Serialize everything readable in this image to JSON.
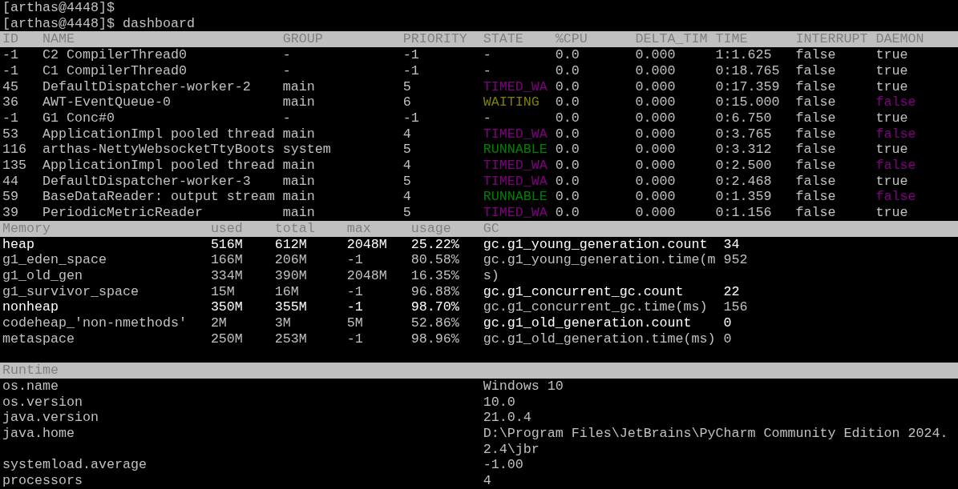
{
  "terminal": {
    "prompt_lines": [
      "[arthas@4448]$",
      "[arthas@4448]$ dashboard"
    ],
    "threads": {
      "columns": [
        "ID",
        "NAME",
        "GROUP",
        "PRIORITY",
        "STATE",
        "%CPU",
        "DELTA_TIM",
        "TIME",
        "INTERRUPT",
        "DAEMON"
      ],
      "rows": [
        {
          "id": "-1",
          "name": "C2 CompilerThread0",
          "group": "-",
          "priority": "-1",
          "state": {
            "text": "-",
            "color": "#c0c0c0"
          },
          "cpu": "0.0",
          "delta_time": "0.000",
          "time": "1:1.625",
          "interrupt": "false",
          "daemon": {
            "text": "true",
            "color": "#c0c0c0"
          }
        },
        {
          "id": "-1",
          "name": "C1 CompilerThread0",
          "group": "-",
          "priority": "-1",
          "state": {
            "text": "-",
            "color": "#c0c0c0"
          },
          "cpu": "0.0",
          "delta_time": "0.000",
          "time": "0:18.765",
          "interrupt": "false",
          "daemon": {
            "text": "true",
            "color": "#c0c0c0"
          }
        },
        {
          "id": "45",
          "name": "DefaultDispatcher-worker-2",
          "group": "main",
          "priority": "5",
          "state": {
            "text": "TIMED_WA",
            "color": "#800080"
          },
          "cpu": "0.0",
          "delta_time": "0.000",
          "time": "0:17.359",
          "interrupt": "false",
          "daemon": {
            "text": "true",
            "color": "#c0c0c0"
          }
        },
        {
          "id": "36",
          "name": "AWT-EventQueue-0",
          "group": "main",
          "priority": "6",
          "state": {
            "text": "WAITING",
            "color": "#808000"
          },
          "cpu": "0.0",
          "delta_time": "0.000",
          "time": "0:15.000",
          "interrupt": "false",
          "daemon": {
            "text": "false",
            "color": "#800080"
          }
        },
        {
          "id": "-1",
          "name": "G1 Conc#0",
          "group": "-",
          "priority": "-1",
          "state": {
            "text": "-",
            "color": "#c0c0c0"
          },
          "cpu": "0.0",
          "delta_time": "0.000",
          "time": "0:6.750",
          "interrupt": "false",
          "daemon": {
            "text": "true",
            "color": "#c0c0c0"
          }
        },
        {
          "id": "53",
          "name": "ApplicationImpl pooled thread",
          "group": "main",
          "priority": "4",
          "state": {
            "text": "TIMED_WA",
            "color": "#800080"
          },
          "cpu": "0.0",
          "delta_time": "0.000",
          "time": "0:3.765",
          "interrupt": "false",
          "daemon": {
            "text": "false",
            "color": "#800080"
          }
        },
        {
          "id": "116",
          "name": "arthas-NettyWebsocketTtyBoots",
          "group": "system",
          "priority": "5",
          "state": {
            "text": "RUNNABLE",
            "color": "#008000"
          },
          "cpu": "0.0",
          "delta_time": "0.000",
          "time": "0:3.312",
          "interrupt": "false",
          "daemon": {
            "text": "true",
            "color": "#c0c0c0"
          }
        },
        {
          "id": "135",
          "name": "ApplicationImpl pooled thread",
          "group": "main",
          "priority": "4",
          "state": {
            "text": "TIMED_WA",
            "color": "#800080"
          },
          "cpu": "0.0",
          "delta_time": "0.000",
          "time": "0:2.500",
          "interrupt": "false",
          "daemon": {
            "text": "false",
            "color": "#800080"
          }
        },
        {
          "id": "44",
          "name": "DefaultDispatcher-worker-3",
          "group": "main",
          "priority": "5",
          "state": {
            "text": "TIMED_WA",
            "color": "#800080"
          },
          "cpu": "0.0",
          "delta_time": "0.000",
          "time": "0:2.468",
          "interrupt": "false",
          "daemon": {
            "text": "true",
            "color": "#c0c0c0"
          }
        },
        {
          "id": "59",
          "name": "BaseDataReader: output stream",
          "group": "main",
          "priority": "4",
          "state": {
            "text": "RUNNABLE",
            "color": "#008000"
          },
          "cpu": "0.0",
          "delta_time": "0.000",
          "time": "0:1.359",
          "interrupt": "false",
          "daemon": {
            "text": "false",
            "color": "#800080"
          }
        },
        {
          "id": "39",
          "name": "PeriodicMetricReader",
          "group": "main",
          "priority": "5",
          "state": {
            "text": "TIMED_WA",
            "color": "#800080"
          },
          "cpu": "0.0",
          "delta_time": "0.000",
          "time": "0:1.156",
          "interrupt": "false",
          "daemon": {
            "text": "true",
            "color": "#c0c0c0"
          }
        }
      ]
    },
    "memory": {
      "columns": [
        "Memory",
        "used",
        "total",
        "max",
        "usage",
        "GC"
      ],
      "rows": [
        {
          "name": "heap",
          "used": "516M",
          "total": "612M",
          "max": "2048M",
          "usage": "25.22%",
          "bold": true
        },
        {
          "name": "g1_eden_space",
          "used": "166M",
          "total": "206M",
          "max": "-1",
          "usage": "80.58%",
          "bold": false
        },
        {
          "name": "g1_old_gen",
          "used": "334M",
          "total": "390M",
          "max": "2048M",
          "usage": "16.35%",
          "bold": false
        },
        {
          "name": "g1_survivor_space",
          "used": "15M",
          "total": "16M",
          "max": "-1",
          "usage": "96.88%",
          "bold": false
        },
        {
          "name": "nonheap",
          "used": "350M",
          "total": "355M",
          "max": "-1",
          "usage": "98.70%",
          "bold": true
        },
        {
          "name": "codeheap_'non-nmethods'",
          "used": "2M",
          "total": "3M",
          "max": "5M",
          "usage": "52.86%",
          "bold": false
        },
        {
          "name": "metaspace",
          "used": "250M",
          "total": "253M",
          "max": "-1",
          "usage": "98.96%",
          "bold": false
        }
      ],
      "gc": [
        {
          "key": "gc.g1_young_generation.count",
          "value": "34",
          "bold": true
        },
        {
          "key": "gc.g1_young_generation.time(ms)",
          "value": "952",
          "bold": false
        },
        {
          "key": "gc.g1_concurrent_gc.count",
          "value": "22",
          "bold": true
        },
        {
          "key": "gc.g1_concurrent_gc.time(ms)",
          "value": "156",
          "bold": false
        },
        {
          "key": "gc.g1_old_generation.count",
          "value": "0",
          "bold": true
        },
        {
          "key": "gc.g1_old_generation.time(ms)",
          "value": "0",
          "bold": false
        }
      ]
    },
    "runtime": {
      "title": "Runtime",
      "rows": [
        {
          "key": "os.name",
          "value": "Windows 10"
        },
        {
          "key": "os.version",
          "value": "10.0"
        },
        {
          "key": "java.version",
          "value": "21.0.4"
        },
        {
          "key": "java.home",
          "value": "D:\\Program Files\\JetBrains\\PyCharm Community Edition 2024.2.4\\jbr"
        },
        {
          "key": "systemload.average",
          "value": "-1.00"
        },
        {
          "key": "processors",
          "value": "4"
        }
      ]
    }
  }
}
